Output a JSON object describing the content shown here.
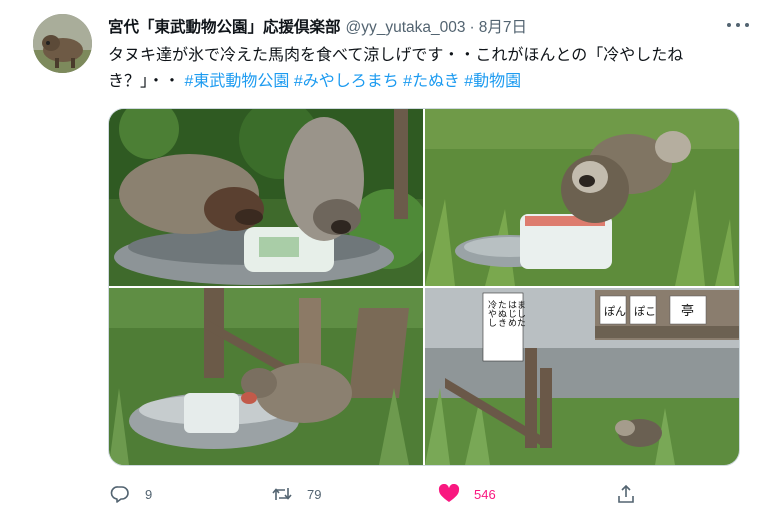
{
  "author": {
    "display_name": "宮代「東武動物公園」応援倶楽部",
    "handle": "@yy_yutaka_003",
    "separator": "·",
    "date": "8月7日"
  },
  "tweet": {
    "text_plain": "タヌキ達が氷で冷えた馬肉を食べて涼しげです・・これがほんとの「冷やしたねき？」・・ ",
    "hashtags": [
      "#東武動物公園",
      "#みやしろまち",
      "#たぬき",
      "#動物園"
    ]
  },
  "photos": {
    "sign_vertical": "冷やしたぬきはじめました",
    "sign_vertical_cols": [
      "冷やし",
      "たぬき",
      "はじめ",
      "ました"
    ],
    "sign_horizontal_chars": [
      "ぽ",
      "ん",
      "ぽ",
      "こ",
      "亭"
    ]
  },
  "actions": {
    "reply_count": "9",
    "retweet_count": "79",
    "like_count": "546"
  },
  "icons": {
    "more": "more-icon",
    "reply": "reply-icon",
    "retweet": "retweet-icon",
    "like": "heart-icon",
    "share": "share-icon"
  },
  "colors": {
    "hashtag": "#1d9bf0",
    "like": "#f91880",
    "muted": "#536471"
  }
}
